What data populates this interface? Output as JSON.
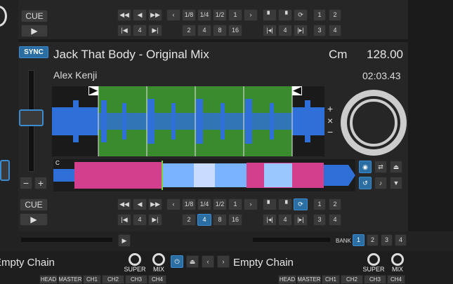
{
  "deck_top": {
    "cue_label": "CUE",
    "play_icon": "play-icon",
    "beatjump": {
      "sizes_row": [
        "1/8",
        "1/4",
        "1/2",
        "1"
      ],
      "sizes_row2": [
        "2",
        "4",
        "8",
        "16"
      ]
    },
    "loop": {
      "size": "4"
    },
    "hotcues": [
      "1",
      "2",
      "3",
      "4"
    ]
  },
  "deck_main": {
    "sync_label": "SYNC",
    "track_title": "Jack That Body - Original Mix",
    "key": "Cm",
    "bpm": "128.00",
    "artist": "Alex Kenji",
    "time": "02:03.43",
    "cue_label": "CUE",
    "overview_marker": "C",
    "beatjump": {
      "sizes_row": [
        "1/8",
        "1/4",
        "1/2",
        "1"
      ],
      "sizes_row2": [
        "2",
        "4",
        "8",
        "16"
      ],
      "active": "4"
    },
    "loop": {
      "size": "4"
    },
    "hotcues": [
      "1",
      "2",
      "3",
      "4"
    ],
    "zoom": {
      "plus": "+",
      "reset": "×",
      "minus": "−"
    },
    "pitch": {
      "minus": "−",
      "plus": "+"
    }
  },
  "bank": {
    "label": "BANK",
    "items": [
      "1",
      "2",
      "3",
      "4"
    ],
    "active": "1"
  },
  "fx": {
    "left_chain": "Empty Chain",
    "right_chain": "Empty Chain",
    "super_label": "SUPER",
    "mix_label": "MIX",
    "routing": [
      "HEAD",
      "MASTER",
      "CH1",
      "CH2",
      "CH3",
      "CH4"
    ]
  },
  "colors": {
    "accent": "#2a6ea3",
    "loop_green": "#3a8a2e",
    "wave_blue": "#2f6fd8",
    "overview_pink": "#d43f8d"
  }
}
